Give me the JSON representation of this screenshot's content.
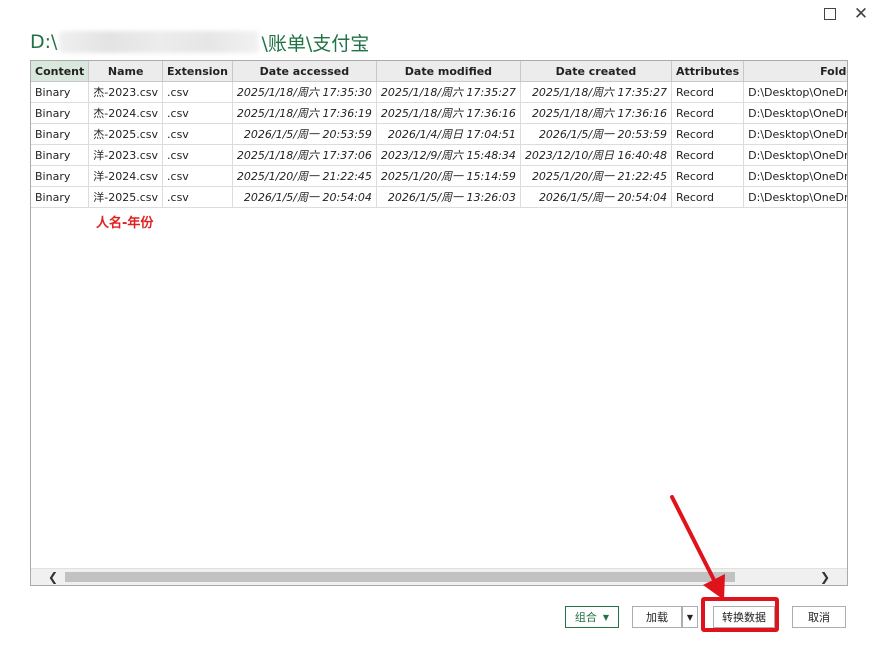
{
  "window": {
    "maximize_icon": "maximize-icon",
    "close_icon": "close-icon",
    "close_glyph": "✕"
  },
  "path": {
    "prefix": "D:\\",
    "suffix": "\\账单\\支付宝"
  },
  "table": {
    "headers": [
      "Content",
      "Name",
      "Extension",
      "Date accessed",
      "Date modified",
      "Date created",
      "Attributes",
      "Folder Pat"
    ],
    "rows": [
      [
        "Binary",
        "杰-2023.csv",
        ".csv",
        "2025/1/18/周六 17:35:30",
        "2025/1/18/周六 17:35:27",
        "2025/1/18/周六 17:35:27",
        "Record",
        "D:\\Desktop\\OneDrive\\附"
      ],
      [
        "Binary",
        "杰-2024.csv",
        ".csv",
        "2025/1/18/周六 17:36:19",
        "2025/1/18/周六 17:36:16",
        "2025/1/18/周六 17:36:16",
        "Record",
        "D:\\Desktop\\OneDrive\\附"
      ],
      [
        "Binary",
        "杰-2025.csv",
        ".csv",
        "2026/1/5/周一 20:53:59",
        "2026/1/4/周日 17:04:51",
        "2026/1/5/周一 20:53:59",
        "Record",
        "D:\\Desktop\\OneDrive\\附"
      ],
      [
        "Binary",
        "洋-2023.csv",
        ".csv",
        "2025/1/18/周六 17:37:06",
        "2023/12/9/周六 15:48:34",
        "2023/12/10/周日 16:40:48",
        "Record",
        "D:\\Desktop\\OneDrive\\附"
      ],
      [
        "Binary",
        "洋-2024.csv",
        ".csv",
        "2025/1/20/周一 21:22:45",
        "2025/1/20/周一 15:14:59",
        "2025/1/20/周一 21:22:45",
        "Record",
        "D:\\Desktop\\OneDrive\\附"
      ],
      [
        "Binary",
        "洋-2025.csv",
        ".csv",
        "2026/1/5/周一 20:54:04",
        "2026/1/5/周一 13:26:03",
        "2026/1/5/周一 20:54:04",
        "Record",
        "D:\\Desktop\\OneDrive\\附"
      ]
    ]
  },
  "annotation": {
    "text": "人名-年份",
    "color": "#e02020"
  },
  "scrollbar": {
    "left_glyph": "❮",
    "right_glyph": "❯"
  },
  "buttons": {
    "combine": "组合",
    "load": "加载",
    "dropdown_glyph": "▼",
    "transform": "转换数据",
    "cancel": "取消"
  },
  "colors": {
    "accent": "#217346",
    "highlight": "#e0121b"
  }
}
